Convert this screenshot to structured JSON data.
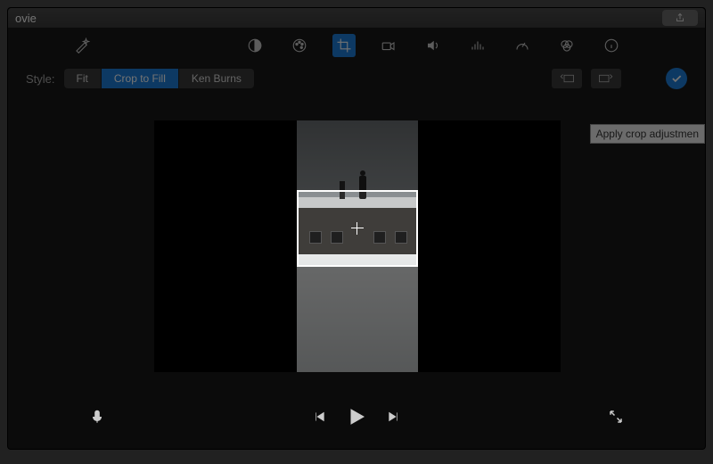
{
  "titlebar": {
    "app_title": "ovie"
  },
  "toolbar_icons": {
    "enhance": "magic-wand-icon",
    "balance": "color-balance-icon",
    "palette": "palette-icon",
    "crop": "crop-icon",
    "stabilize": "camera-icon",
    "volume": "volume-icon",
    "eq": "equalizer-icon",
    "speed": "speedometer-icon",
    "filters": "color-filter-icon",
    "info": "info-icon"
  },
  "stylebar": {
    "label": "Style:",
    "options": [
      "Fit",
      "Crop to Fill",
      "Ken Burns"
    ],
    "selected": "Crop to Fill",
    "rotate_ccw": "rotate-ccw-icon",
    "rotate_cw": "rotate-cw-icon",
    "apply_tooltip": "Apply crop adjustmen"
  },
  "transport": {
    "mic": "mic-icon",
    "prev": "skip-start-icon",
    "play": "play-icon",
    "next": "skip-end-icon",
    "fullscreen": "expand-icon"
  },
  "colors": {
    "accent": "#1e7fdb",
    "bg": "#1a1a1a"
  }
}
